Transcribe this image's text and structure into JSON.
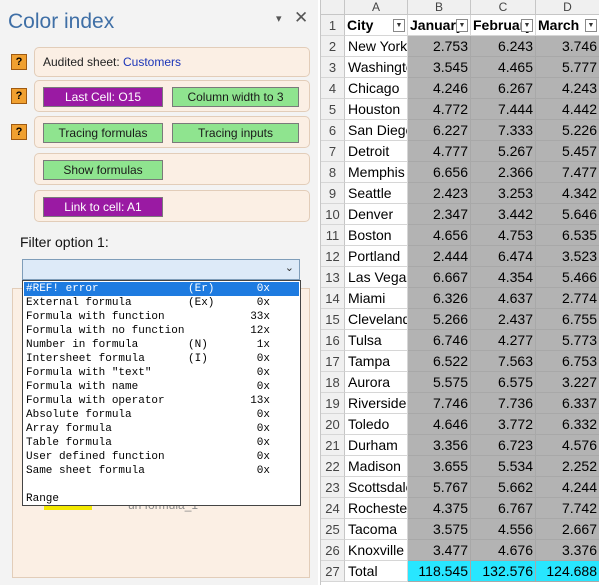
{
  "pane": {
    "title": "Color index",
    "menu_glyph": "▾",
    "close_glyph": "✕",
    "help_glyph": "?",
    "audited_label": "Audited sheet:",
    "audited_value": "Customers",
    "last_cell_button": "Last Cell: O15",
    "column_width_button": "Column width to 3",
    "tracing_formulas_button": "Tracing formulas",
    "tracing_inputs_button": "Tracing inputs",
    "show_formulas_button": "Show formulas",
    "link_button": "Link to cell: A1",
    "filter_label": "Filter option 1:",
    "hidden_item_text": "un formula_1",
    "dropdown_items": [
      {
        "name": "#REF! error",
        "code": "(Er)",
        "count": "0x"
      },
      {
        "name": "External formula",
        "code": "(Ex)",
        "count": "0x"
      },
      {
        "name": "Formula with function",
        "code": "",
        "count": "33x"
      },
      {
        "name": "Formula with no function",
        "code": "",
        "count": "12x"
      },
      {
        "name": "Number in formula",
        "code": "(N)",
        "count": "1x"
      },
      {
        "name": "Intersheet formula",
        "code": "(I)",
        "count": "0x"
      },
      {
        "name": "Formula with \"text\"",
        "code": "",
        "count": "0x"
      },
      {
        "name": "Formula with name",
        "code": "",
        "count": "0x"
      },
      {
        "name": "Formula with operator",
        "code": "",
        "count": "13x"
      },
      {
        "name": "Absolute formula",
        "code": "",
        "count": "0x"
      },
      {
        "name": "Array formula",
        "code": "",
        "count": "0x"
      },
      {
        "name": "Table formula",
        "code": "",
        "count": "0x"
      },
      {
        "name": "User defined function",
        "code": "",
        "count": "0x"
      },
      {
        "name": "Same sheet formula",
        "code": "",
        "count": "0x"
      },
      {
        "name": "",
        "code": "",
        "count": ""
      },
      {
        "name": "Range",
        "code": "",
        "count": ""
      }
    ],
    "selected_index": 0
  },
  "sheet": {
    "columns": [
      "A",
      "B",
      "C",
      "D"
    ],
    "filter_glyph": "▼",
    "header_row": {
      "row": "1",
      "cells": [
        "City",
        "January",
        "February",
        "March"
      ]
    },
    "rows": [
      {
        "row": "2",
        "city": "New York",
        "values": [
          "2.753",
          "6.243",
          "3.746"
        ]
      },
      {
        "row": "3",
        "city": "Washington",
        "values": [
          "3.545",
          "4.465",
          "5.777"
        ]
      },
      {
        "row": "4",
        "city": "Chicago",
        "values": [
          "4.246",
          "6.267",
          "4.243"
        ]
      },
      {
        "row": "5",
        "city": "Houston",
        "values": [
          "4.772",
          "7.444",
          "4.442"
        ]
      },
      {
        "row": "6",
        "city": "San Diego",
        "values": [
          "6.227",
          "7.333",
          "5.226"
        ]
      },
      {
        "row": "7",
        "city": "Detroit",
        "values": [
          "4.777",
          "5.267",
          "5.457"
        ]
      },
      {
        "row": "8",
        "city": "Memphis",
        "values": [
          "6.656",
          "2.366",
          "7.477"
        ]
      },
      {
        "row": "9",
        "city": "Seattle",
        "values": [
          "2.423",
          "3.253",
          "4.342"
        ]
      },
      {
        "row": "10",
        "city": "Denver",
        "values": [
          "2.347",
          "3.442",
          "5.646"
        ]
      },
      {
        "row": "11",
        "city": "Boston",
        "values": [
          "4.656",
          "4.753",
          "6.535"
        ]
      },
      {
        "row": "12",
        "city": "Portland",
        "values": [
          "2.444",
          "6.474",
          "3.523"
        ]
      },
      {
        "row": "13",
        "city": "Las Vegas",
        "values": [
          "6.667",
          "4.354",
          "5.466"
        ]
      },
      {
        "row": "14",
        "city": "Miami",
        "values": [
          "6.326",
          "4.637",
          "2.774"
        ]
      },
      {
        "row": "15",
        "city": "Cleveland",
        "values": [
          "5.266",
          "2.437",
          "6.755"
        ]
      },
      {
        "row": "16",
        "city": "Tulsa",
        "values": [
          "6.746",
          "4.277",
          "5.773"
        ]
      },
      {
        "row": "17",
        "city": "Tampa",
        "values": [
          "6.522",
          "7.563",
          "6.753"
        ]
      },
      {
        "row": "18",
        "city": "Aurora",
        "values": [
          "5.575",
          "6.575",
          "3.227"
        ]
      },
      {
        "row": "19",
        "city": "Riverside",
        "values": [
          "7.746",
          "7.736",
          "6.337"
        ]
      },
      {
        "row": "20",
        "city": "Toledo",
        "values": [
          "4.646",
          "3.772",
          "6.332"
        ]
      },
      {
        "row": "21",
        "city": "Durham",
        "values": [
          "3.356",
          "6.723",
          "4.576"
        ]
      },
      {
        "row": "22",
        "city": "Madison",
        "values": [
          "3.655",
          "5.534",
          "2.252"
        ]
      },
      {
        "row": "23",
        "city": "Scottsdale",
        "values": [
          "5.767",
          "5.662",
          "4.244"
        ]
      },
      {
        "row": "24",
        "city": "Rochester",
        "values": [
          "4.375",
          "6.767",
          "7.742"
        ]
      },
      {
        "row": "25",
        "city": "Tacoma",
        "values": [
          "3.575",
          "4.556",
          "2.667"
        ]
      },
      {
        "row": "26",
        "city": "Knoxville",
        "values": [
          "3.477",
          "4.676",
          "3.376"
        ]
      }
    ],
    "total_row": {
      "row": "27",
      "label": "Total",
      "values": [
        "118.545",
        "132.576",
        "124.688"
      ]
    }
  },
  "colors": {
    "button_purple": "#9a1aa3",
    "button_green": "#8fe48f",
    "help_orange": "#f0a030",
    "formula_cell_gray": "#b3b3b3",
    "total_cell_cyan": "#28e6ff",
    "dropdown_selected": "#1e7be0"
  }
}
